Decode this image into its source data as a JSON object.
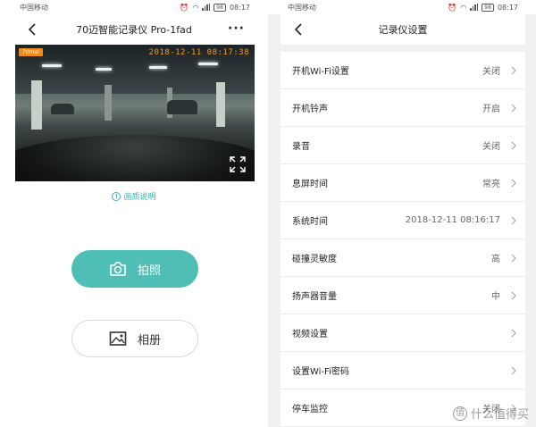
{
  "status_bar": {
    "carrier": "中国移动",
    "battery": "98",
    "time": "08:17"
  },
  "left_screen": {
    "title": "70迈智能记录仪 Pro-1fad",
    "video": {
      "brand_badge": "70mai",
      "timestamp": "2018-12-11 08:17:38"
    },
    "quality_link": "画质说明",
    "photo_button": "拍照",
    "album_button": "相册"
  },
  "right_screen": {
    "title": "记录仪设置",
    "settings": [
      {
        "label": "开机Wi-Fi设置",
        "value": "关闭"
      },
      {
        "label": "开机铃声",
        "value": "开启"
      },
      {
        "label": "录音",
        "value": "关闭"
      },
      {
        "label": "息屏时间",
        "value": "常亮"
      },
      {
        "label": "系统时间",
        "value": "2018-12-11 08:16:17"
      },
      {
        "label": "碰撞灵敏度",
        "value": "高"
      },
      {
        "label": "扬声器音量",
        "value": "中"
      },
      {
        "label": "视频设置",
        "value": ""
      },
      {
        "label": "设置Wi-Fi密码",
        "value": ""
      },
      {
        "label": "停车监控",
        "value": "关闭"
      }
    ]
  },
  "watermark": "什么值得买",
  "colors": {
    "accent": "#4fbeb4",
    "link": "#3bb5ad",
    "timestamp_orange": "#f59a25",
    "badge_orange": "#f08a1c"
  },
  "icons": [
    "back-arrow-icon",
    "more-dots-icon",
    "fullscreen-icon",
    "info-icon",
    "camera-icon",
    "image-icon",
    "chevron-right-icon",
    "wifi-icon",
    "signal-icon",
    "battery-icon",
    "alarm-icon",
    "watermark-logo-icon"
  ]
}
